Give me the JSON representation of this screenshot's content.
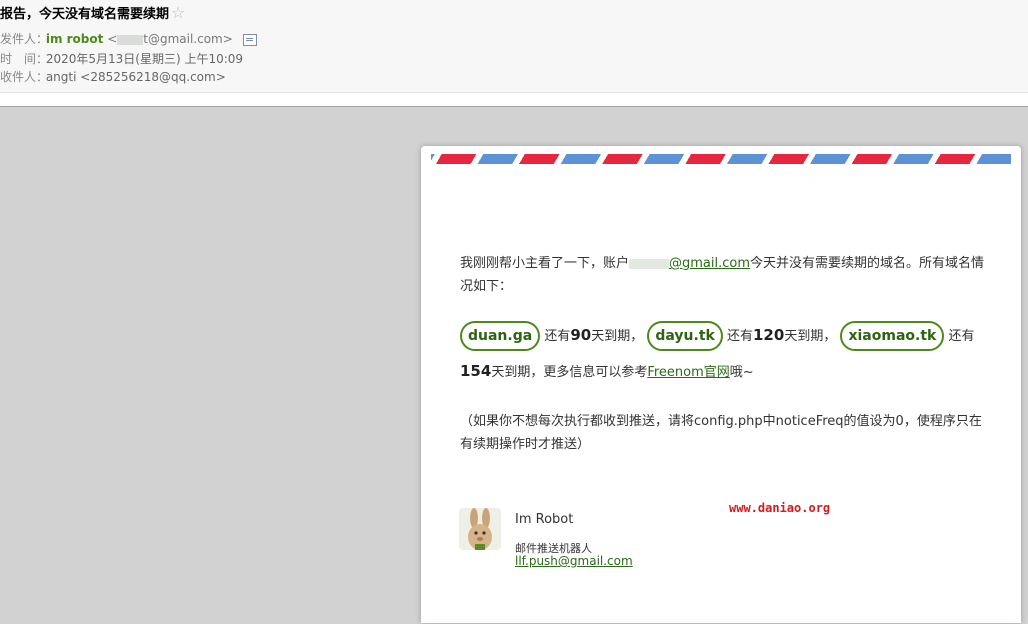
{
  "header": {
    "subject": "报告，今天没有域名需要续期",
    "sender_label": "发件人：",
    "sender_name": "im robot",
    "sender_email_prefix": "<",
    "sender_email_suffix": "t@gmail.com>",
    "time_label": "时　间：",
    "time_value": "2020年5月13日(星期三) 上午10:09",
    "recipient_label": "收件人：",
    "recipient_value": "angti <285256218@qq.com>"
  },
  "mail": {
    "intro_a": "我刚刚帮小主看了一下，账户",
    "intro_email": "@gmail.com",
    "intro_b": "今天并没有需要续期的域名。所有域名情况如下：",
    "domains": [
      {
        "name": "duan.ga",
        "pre": "还有",
        "days": "90",
        "post": "天到期，"
      },
      {
        "name": "dayu.tk",
        "pre": "还有",
        "days": "120",
        "post": "天到期，"
      },
      {
        "name": "xiaomao.tk",
        "pre": "还有",
        "days": "154",
        "post": "天到期，"
      }
    ],
    "more_info": "更多信息可以参考",
    "freenom_link": "Freenom官网",
    "more_tail": "哦~",
    "note": "（如果你不想每次执行都收到推送，请将config.php中noticeFreq的值设为0，使程序只在有续期操作时才推送）",
    "watermark": "www.daniao.org",
    "signature": {
      "name": "Im Robot",
      "role": "邮件推送机器人",
      "email": "llf.push@gmail.com"
    }
  },
  "colors": {
    "accent_green": "#4d8a1b",
    "stripe_blue": "#5d92d6",
    "stripe_red": "#e7263f",
    "watermark_red": "#d81a1a"
  }
}
